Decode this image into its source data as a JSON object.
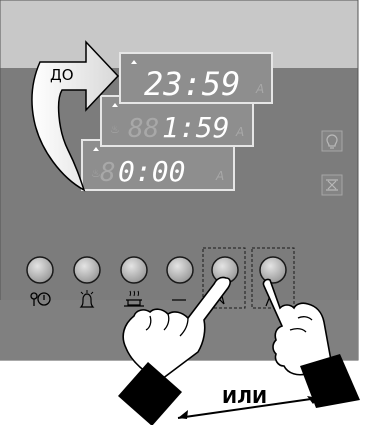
{
  "labels": {
    "before": "ДО",
    "or": "ИЛИ"
  },
  "displays": {
    "back": {
      "time": "0:00",
      "ghost": "8",
      "unit": "A"
    },
    "middle": {
      "time": "1:59",
      "ghost": "88",
      "unit": "A"
    },
    "front": {
      "time": "23:59",
      "unit": "A"
    }
  },
  "buttons": [
    {
      "name": "clock-button",
      "icon": "key-clock-icon"
    },
    {
      "name": "timer-button",
      "icon": "bell-icon"
    },
    {
      "name": "cooking-time-button",
      "icon": "pot-icon"
    },
    {
      "name": "end-time-button",
      "icon": "pot-end-icon"
    },
    {
      "name": "minus-button",
      "icon": "down-arrow-icon",
      "highlighted": true
    },
    {
      "name": "plus-button",
      "icon": "up-arrow-icon",
      "highlighted": true
    }
  ],
  "side_icons": [
    "lamp-icon",
    "defrost-icon"
  ],
  "colors": {
    "panel_top": "#c8c8c8",
    "panel": "#7c7c7c",
    "display": "#8e8e8e",
    "button": "#b4b4b4",
    "arrow_outline": "#000000"
  }
}
